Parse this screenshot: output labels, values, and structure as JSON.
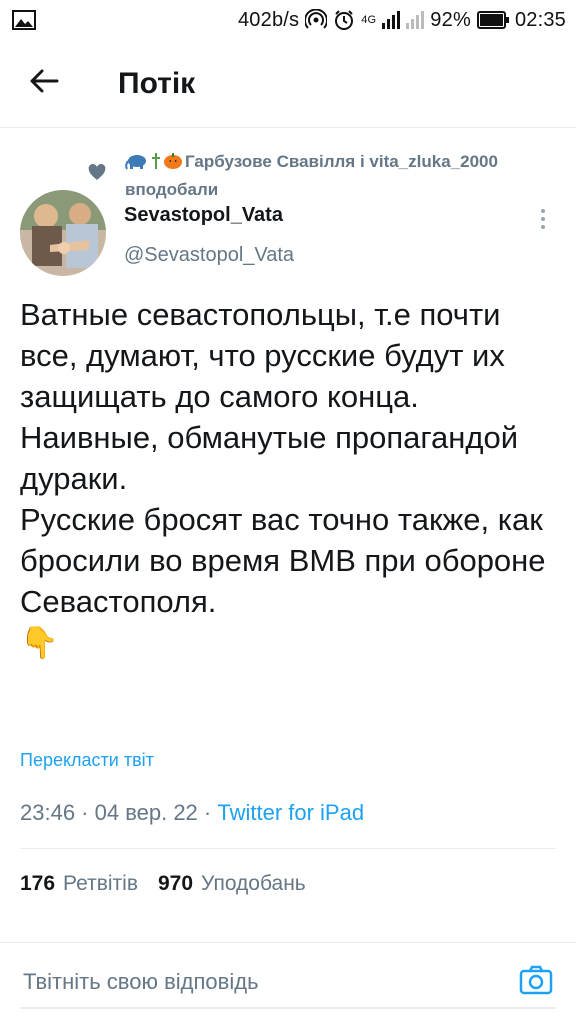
{
  "status_bar": {
    "speed": "402b/s",
    "network": "4G",
    "battery": "92%",
    "time": "02:35",
    "icons": [
      "gallery-icon",
      "hotspot-icon",
      "alarm-icon",
      "signal-icon",
      "battery-icon"
    ]
  },
  "header": {
    "title": "Потік",
    "back_icon": "arrow-left-icon"
  },
  "social_context": {
    "text": "Гарбузове Свавілля і vita_zluka_2000 вподобали",
    "icon": "heart-icon"
  },
  "author": {
    "name": "Sevastopol_Vata",
    "handle": "@Sevastopol_Vata"
  },
  "tweet": {
    "text": "Ватные севастопольцы, т.е почти все, думают, что русские будут их защищать до самого конца.\nНаивные, обманутые пропагандой дураки.\nРусские бросят вас точно также, как бросили во время ВМВ при обороне Севастополя.\n👇",
    "translate": "Перекласти твіт",
    "timestamp": "23:46 · 04 вер. 22 · ",
    "source": "Twitter for iPad"
  },
  "stats": {
    "retweets_count": "176",
    "retweets_label": "Ретвітів",
    "likes_count": "970",
    "likes_label": "Уподобань"
  },
  "reply": {
    "placeholder": "Твітніть свою відповідь",
    "camera_icon": "camera-icon"
  },
  "colors": {
    "accent": "#1da1f2",
    "secondary_text": "#657786",
    "divider": "#e6ecf0"
  }
}
